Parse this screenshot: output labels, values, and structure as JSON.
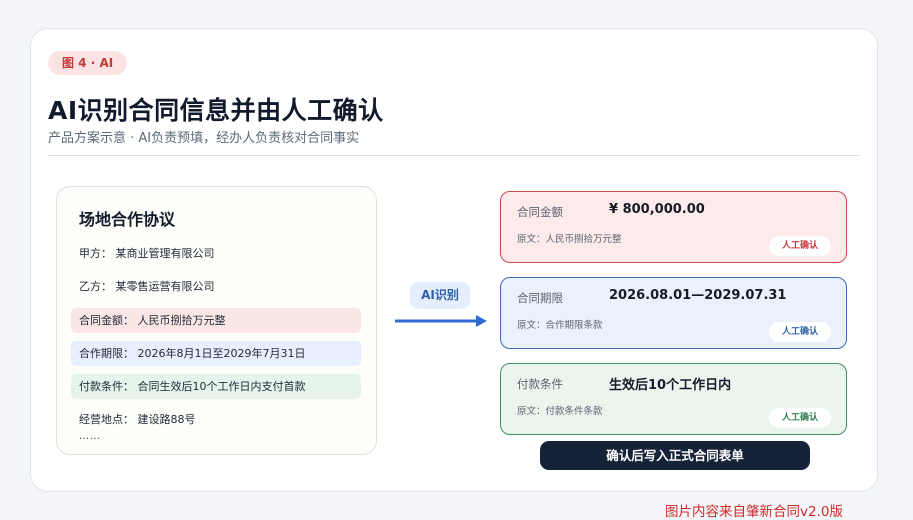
{
  "tag": "图 4 · AI",
  "title": "AI识别合同信息并由人工确认",
  "subtitle": "产品方案示意 · AI负责预填，经办人负责核对合同事实",
  "document": {
    "title": "场地合作协议",
    "lines": [
      "甲方：  某商业管理有限公司",
      "乙方：  某零售运营有限公司",
      "合同金额：  人民币捌拾万元整",
      "合作期限：  2026年8月1日至2029年7月31日",
      "付款条件：  合同生效后10个工作日内支付首款",
      "经营地点：  建设路88号"
    ],
    "more": "……"
  },
  "ai_label": "AI识别",
  "fields": [
    {
      "label": "合同金额",
      "value": "¥ 800,000.00",
      "source": "原文：人民币捌拾万元整",
      "badge": "人工确认"
    },
    {
      "label": "合同期限",
      "value": "2026.08.01—2029.07.31",
      "source": "原文：合作期限条款",
      "badge": "人工确认"
    },
    {
      "label": "付款条件",
      "value": "生效后10个工作日内",
      "source": "原文：付款条件条款",
      "badge": "人工确认"
    }
  ],
  "confirm_button": "确认后写入正式合同表单",
  "watermark": "图片内容来自肇新合同v2.0版",
  "colors": {
    "amount": "#c94c4c",
    "term": "#3d6ab5",
    "payment": "#3f8f62",
    "button": "#162238",
    "arrow": "#2f6bd0"
  },
  "icons": [
    "arrow-right-icon"
  ]
}
